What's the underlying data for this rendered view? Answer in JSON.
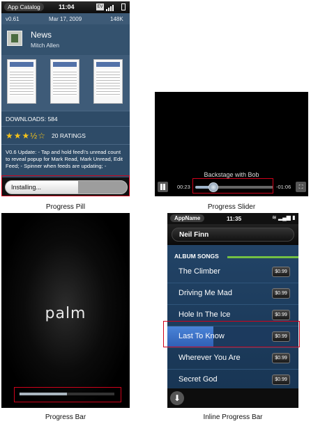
{
  "captions": {
    "pill": "Progress Pill",
    "slider": "Progress Slider",
    "bar": "Progress Bar",
    "inline": "Inline Progress Bar"
  },
  "app_catalog": {
    "status_app": "App Catalog",
    "time": "11:04",
    "ev": "EV",
    "version": "v0.61",
    "date": "Mar 17, 2009",
    "size": "148K",
    "app_title": "News",
    "author": "Mitch Allen",
    "downloads": "DOWNLOADS: 584",
    "stars": "★★★½☆",
    "ratings": "20 RATINGS",
    "description": "V0.6 Update: - Tap and hold feed\\'s unread count to reveal popup for Mark Read, Mark Unread, Edit Feed; - Spinner when feeds are updating; -",
    "install_label": "Installing...",
    "install_progress": 0.6
  },
  "video": {
    "title": "Backstage with Bob",
    "elapsed": "00:23",
    "remaining": "-01:06",
    "progress": 0.23,
    "pause_icon": "pause-icon",
    "aspect_icon": "aspect-ratio-icon"
  },
  "boot": {
    "logo": "palm",
    "progress": 0.5
  },
  "music": {
    "app_name": "AppName",
    "time": "11:35",
    "artist": "Neil Finn",
    "section": "ALBUM SONGS",
    "songs": [
      {
        "title": "The Climber",
        "price": "$0.99",
        "progress": 0
      },
      {
        "title": "Driving Me Mad",
        "price": "$0.99",
        "progress": 0
      },
      {
        "title": "Hole In The Ice",
        "price": "$0.99",
        "progress": 0
      },
      {
        "title": "Last To Know",
        "price": "$0.99",
        "progress": 0.35
      },
      {
        "title": "Wherever You Are",
        "price": "$0.99",
        "progress": 0
      },
      {
        "title": "Secret God",
        "price": "$0.99",
        "progress": 0
      }
    ],
    "accent": "#74c043"
  }
}
